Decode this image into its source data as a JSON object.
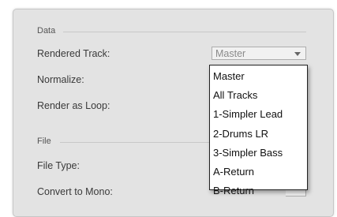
{
  "sections": {
    "data": "Data",
    "file": "File"
  },
  "rows": {
    "rendered_track": "Rendered Track:",
    "normalize": "Normalize:",
    "render_as_loop": "Render as Loop:",
    "file_type": "File Type:",
    "convert_to_mono": "Convert to Mono:"
  },
  "rendered_track_select": {
    "value": "Master"
  },
  "dropdown": {
    "items": [
      {
        "label": "Master"
      },
      {
        "label": "All Tracks"
      },
      {
        "label": "1-Simpler Lead"
      },
      {
        "label": "2-Drums LR"
      },
      {
        "label": "3-Simpler Bass"
      },
      {
        "label": "A-Return"
      },
      {
        "label": "B-Return"
      }
    ]
  },
  "colors": {
    "panel_bg": "#e3e3e3",
    "menu_bg": "#ffffff",
    "menu_border": "#222222"
  }
}
